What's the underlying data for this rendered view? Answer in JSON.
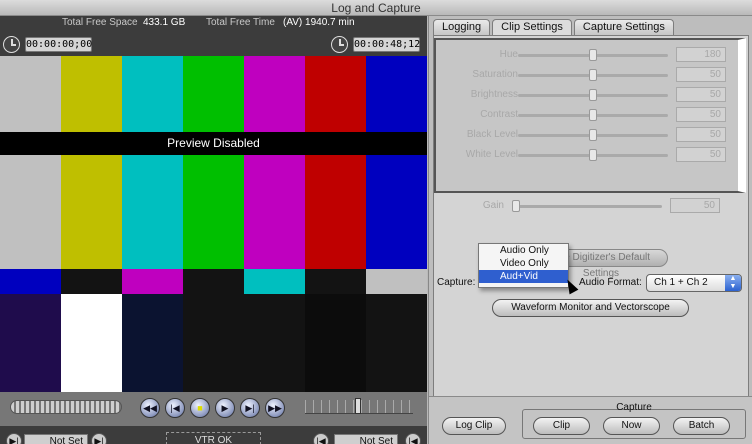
{
  "window": {
    "title": "Log and Capture"
  },
  "viewer": {
    "free_space_label": "Total Free Space",
    "free_space_value": "433.1 GB",
    "free_time_label": "Total Free Time",
    "free_time_value": "(AV) 1940.7 min",
    "timecode_duration": "00:00:00;00",
    "timecode_current": "00:00:48;12",
    "preview_message": "Preview Disabled",
    "vtr_status": "VTR OK",
    "in_point": "Not Set",
    "out_point": "Not Set",
    "bar_colors_top": [
      "#c0c0c0",
      "#bfbf00",
      "#00bfbf",
      "#00bf00",
      "#bf00bf",
      "#bf0000",
      "#0000bf"
    ],
    "bar_colors_mid": [
      "#0000bf",
      "#131313",
      "#bf00bf",
      "#131313",
      "#00bfbf",
      "#131313",
      "#c0c0c0"
    ],
    "bar_colors_bottom": [
      "#1f0c4c",
      "#ffffff",
      "#0b1330",
      "#131313",
      "#131313",
      "#0c0c0c",
      "#131313"
    ]
  },
  "tabs": [
    {
      "label": "Logging"
    },
    {
      "label": "Clip Settings"
    },
    {
      "label": "Capture Settings"
    }
  ],
  "clip_settings": {
    "sliders": [
      {
        "label": "Hue",
        "value": "180",
        "level": 0.5
      },
      {
        "label": "Saturation",
        "value": "50",
        "level": 0.5
      },
      {
        "label": "Brightness",
        "value": "50",
        "level": 0.5
      },
      {
        "label": "Contrast",
        "value": "50",
        "level": 0.5
      },
      {
        "label": "Black Level",
        "value": "50",
        "level": 0.5
      },
      {
        "label": "White Level",
        "value": "50",
        "level": 0.5
      }
    ],
    "gain_label": "Gain",
    "gain_value": "50",
    "defaults_button": "Use Digitizer's Default Settings",
    "capture_label": "Capture:",
    "audio_format_label": "Audio Format:",
    "audio_format_value": "Ch 1 + Ch 2",
    "waveform_button": "Waveform Monitor and Vectorscope"
  },
  "capture_menu": {
    "options": [
      "Audio Only",
      "Video Only",
      "Aud+Vid"
    ],
    "selected": "Aud+Vid"
  },
  "bottom": {
    "log_clip_button": "Log Clip",
    "capture_group_label": "Capture",
    "clip_button": "Clip",
    "now_button": "Now",
    "batch_button": "Batch"
  }
}
